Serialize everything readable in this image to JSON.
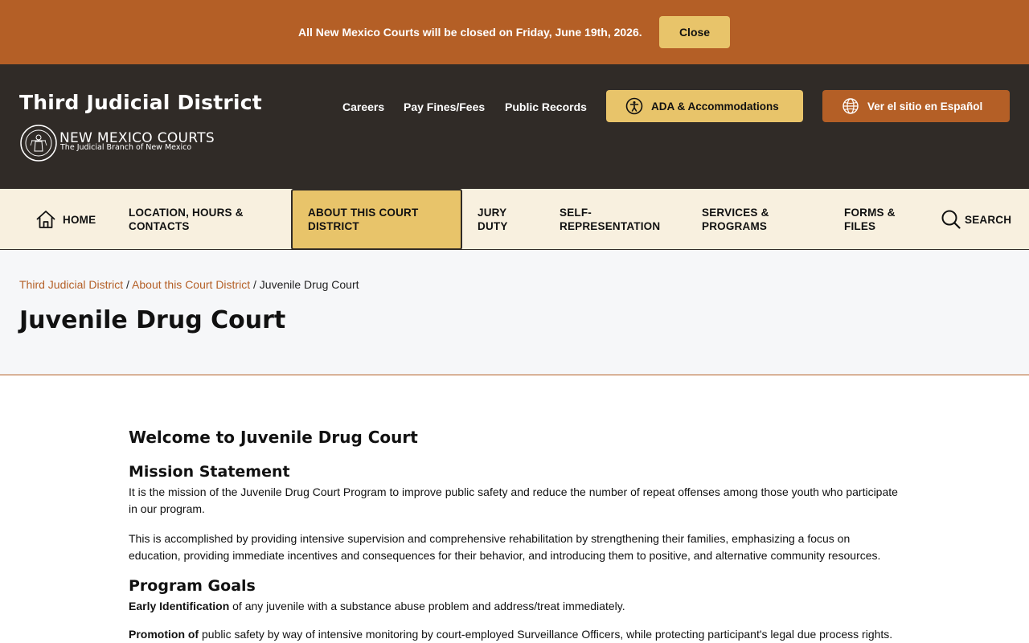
{
  "alert": {
    "message": "All New Mexico Courts will be closed on Friday, June 19th, 2026.",
    "close_label": "Close"
  },
  "header": {
    "site_title": "Third Judicial District",
    "org_name": "NEW MEXICO COURTS",
    "org_tagline": "The Judicial Branch of New Mexico",
    "utility_links": [
      "Careers",
      "Pay Fines/Fees",
      "Public Records"
    ],
    "ada_label": "ADA & Accommodations",
    "spanish_label": "Ver el sitio en Español",
    "colors": {
      "brand_orange": "#b45f26",
      "brand_gold": "#e8c46a",
      "header_dark": "#302b27"
    }
  },
  "nav": {
    "items": [
      "HOME",
      "LOCATION, HOURS & CONTACTS",
      "ABOUT THIS COURT DISTRICT",
      "JURY DUTY",
      "SELF-REPRESENTATION",
      "SERVICES & PROGRAMS",
      "FORMS & FILES"
    ],
    "active_item": "ABOUT THIS COURT DISTRICT",
    "search_label": "SEARCH"
  },
  "breadcrumb": {
    "items": [
      "Third Judicial District",
      "About this Court District",
      "Juvenile Drug Court"
    ],
    "separator": " / "
  },
  "page": {
    "title": "Juvenile Drug Court",
    "welcome_heading": "Welcome to Juvenile Drug Court",
    "mission_heading": "Mission Statement",
    "mission_p1": "It is the mission of the Juvenile Drug Court Program to improve public safety and reduce the number of repeat offenses among those youth who participate in our program.",
    "mission_p2": "This is accomplished by providing intensive supervision and comprehensive rehabilitation by strengthening their families, emphasizing a focus on education, providing immediate incentives and consequences for their behavior, and introducing them to positive, and alternative community resources.",
    "goals_heading": "Program Goals",
    "goal1_bold": "Early Identification",
    "goal1_text": " of any juvenile with a substance abuse problem and address/treat immediately.",
    "goal2_bold": "Promotion of",
    "goal2_text": " public safety by way of intensive monitoring by court-employed Surveillance Officers, while protecting participant's legal due process rights."
  }
}
